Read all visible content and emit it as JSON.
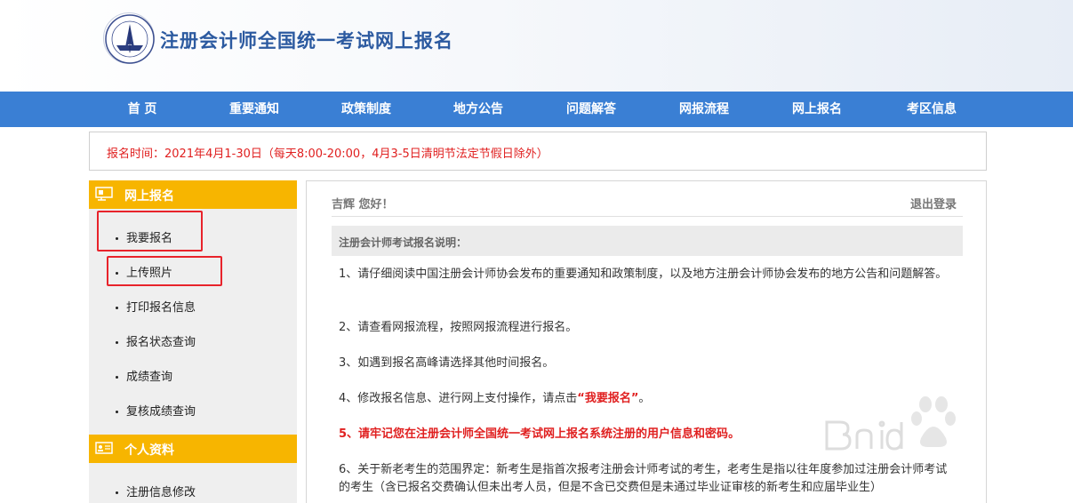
{
  "header": {
    "title": "注册会计师全国统一考试网上报名"
  },
  "nav": {
    "items": [
      "首 页",
      "重要通知",
      "政策制度",
      "地方公告",
      "问题解答",
      "网报流程",
      "网上报名",
      "考区信息"
    ]
  },
  "notice": {
    "text": "报名时间：2021年4月1-30日（每天8:00-20:00，4月3-5日清明节法定节假日除外）"
  },
  "sidebar": {
    "section1": {
      "title": "网上报名",
      "icon": "monitor-icon",
      "items": [
        "我要报名",
        "上传照片",
        "打印报名信息",
        "报名状态查询",
        "成绩查询",
        "复核成绩查询"
      ]
    },
    "section2": {
      "title": "个人资料",
      "icon": "id-card-icon",
      "items": [
        "注册信息修改"
      ]
    }
  },
  "main": {
    "greeting": "吉辉 您好！",
    "logout": "退出登录",
    "section_title": "注册会计师考试报名说明：",
    "paragraphs": {
      "p1": "1、请仔细阅读中国注册会计师协会发布的重要通知和政策制度，以及地方注册会计师协会发布的地方公告和问题解答。",
      "p2": "2、请查看网报流程，按照网报流程进行报名。",
      "p3": "3、如遇到报名高峰请选择其他时间报名。",
      "p4_pre": "4、修改报名信息、进行网上支付操作，请点击",
      "p4_red": "“我要报名”",
      "p4_post": "。",
      "p5_num": "5、",
      "p5_red": "请牢记您在注册会计师全国统一考试网上报名系统注册的用户信息和密码",
      "p5_post": "。",
      "p6": "6、关于新老考生的范围界定：新考生是指首次报考注册会计师考试的考生，老考生是指以往年度参加过注册会计师考试的考生（含已报名交费确认但未出考人员，但是不含已交费但是未通过毕业证审核的新考生和应届毕业生）"
    }
  },
  "colors": {
    "nav_bg": "#3a7fd4",
    "sidebar_header": "#f7b500",
    "title_blue": "#2c5aa0",
    "notice_red": "#e02020",
    "highlight_red": "#e8232b"
  },
  "watermark": {
    "icon": "baidu-paw-icon"
  }
}
